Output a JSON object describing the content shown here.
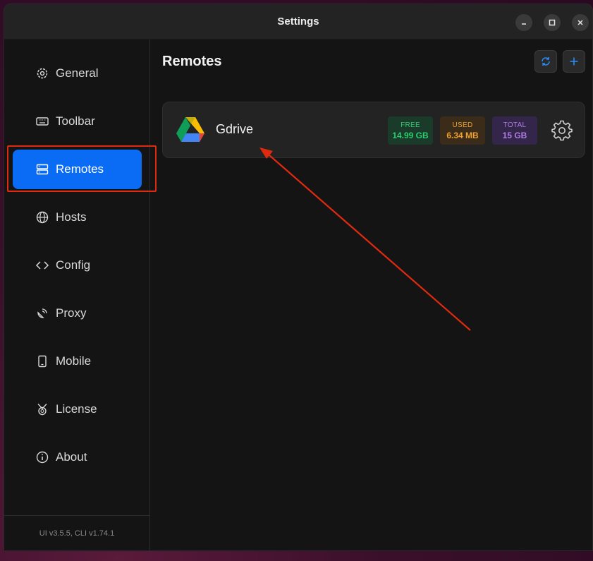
{
  "window": {
    "title": "Settings"
  },
  "sidebar": {
    "items": [
      {
        "label": "General",
        "icon": "gear-cycle-icon"
      },
      {
        "label": "Toolbar",
        "icon": "keyboard-icon"
      },
      {
        "label": "Remotes",
        "icon": "server-icon",
        "active": true
      },
      {
        "label": "Hosts",
        "icon": "globe-icon"
      },
      {
        "label": "Config",
        "icon": "code-icon"
      },
      {
        "label": "Proxy",
        "icon": "satellite-dish-icon"
      },
      {
        "label": "Mobile",
        "icon": "mobile-icon"
      },
      {
        "label": "License",
        "icon": "award-icon"
      },
      {
        "label": "About",
        "icon": "info-icon"
      }
    ],
    "footer": "UI v3.5.5, CLI v1.74.1"
  },
  "main": {
    "title": "Remotes",
    "remotes": [
      {
        "name": "Gdrive",
        "free_label": "FREE",
        "free_value": "14.99 GB",
        "used_label": "USED",
        "used_value": "6.34 MB",
        "total_label": "TOTAL",
        "total_value": "15 GB"
      }
    ]
  },
  "colors": {
    "accent": "#0a6cf5",
    "annotation": "#e02a10",
    "free": "#2ecc71",
    "used": "#f0a030",
    "total": "#b07ee0"
  }
}
